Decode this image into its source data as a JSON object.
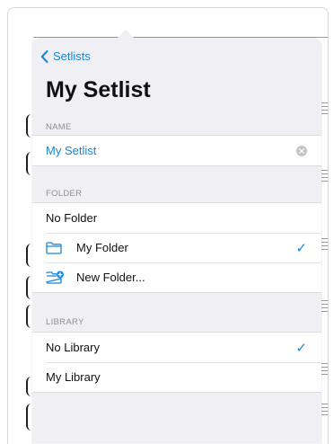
{
  "nav": {
    "back_label": "Setlists"
  },
  "header": {
    "title": "My Setlist"
  },
  "name_section": {
    "label": "NAME",
    "value": "My Setlist"
  },
  "folder_section": {
    "label": "FOLDER",
    "items": [
      {
        "label": "No Folder",
        "icon": "",
        "checked": false
      },
      {
        "label": "My Folder",
        "icon": "folder-icon",
        "checked": true
      },
      {
        "label": "New Folder...",
        "icon": "folder-add-icon",
        "checked": false
      }
    ]
  },
  "library_section": {
    "label": "LIBRARY",
    "items": [
      {
        "label": "No Library",
        "checked": true
      },
      {
        "label": "My Library",
        "checked": false
      }
    ]
  },
  "colors": {
    "accent": "#1a86d6",
    "popover_bg": "#efeff4",
    "secondary_text": "#8e8e93"
  },
  "check_glyph": "✓"
}
